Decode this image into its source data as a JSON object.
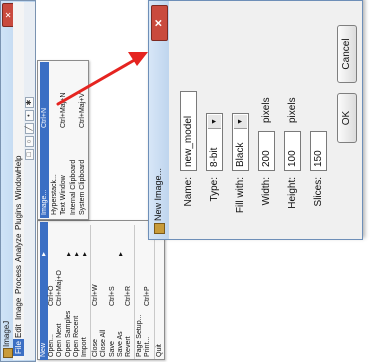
{
  "ij_window": {
    "title": "ImageJ",
    "close_label": "✕",
    "menubar": [
      "File",
      "Edit",
      "Image",
      "Process",
      "Analyze",
      "Plugins",
      "Window",
      "Help"
    ],
    "active_menu": "File",
    "toolbar_glyphs": [
      "□",
      "○",
      "╱",
      "•",
      "✱"
    ]
  },
  "file_menu": {
    "items": [
      {
        "label": "New",
        "shortcut": "",
        "submenu": true,
        "highlighted": true
      },
      {
        "label": "Open...",
        "shortcut": "Ctrl+O"
      },
      {
        "label": "Open Next",
        "shortcut": "Ctrl+Maj+O"
      },
      {
        "label": "Open Samples",
        "shortcut": "",
        "submenu": true
      },
      {
        "label": "Open Recent",
        "shortcut": "",
        "submenu": true
      },
      {
        "label": "Import",
        "shortcut": "",
        "submenu": true
      },
      {
        "separator": true
      },
      {
        "label": "Close",
        "shortcut": "Ctrl+W"
      },
      {
        "label": "Close All",
        "shortcut": ""
      },
      {
        "label": "Save",
        "shortcut": "Ctrl+S"
      },
      {
        "label": "Save As",
        "shortcut": "",
        "submenu": true
      },
      {
        "label": "Revert",
        "shortcut": "Ctrl+R"
      },
      {
        "separator": true
      },
      {
        "label": "Page Setup...",
        "shortcut": ""
      },
      {
        "label": "Print...",
        "shortcut": "Ctrl+P"
      },
      {
        "separator": true
      },
      {
        "label": "Quit",
        "shortcut": ""
      }
    ]
  },
  "new_submenu": {
    "items": [
      {
        "label": "Image...",
        "shortcut": "Ctrl+N",
        "highlighted": true
      },
      {
        "label": "Hyperstack...",
        "shortcut": ""
      },
      {
        "label": "Text Window",
        "shortcut": "Ctrl+Maj+N"
      },
      {
        "label": "Internal Clipboard",
        "shortcut": ""
      },
      {
        "label": "System Clipboard",
        "shortcut": "Ctrl+Maj+V"
      }
    ]
  },
  "dialog": {
    "title": "New Image...",
    "close_label": "✕",
    "name_label": "Name:",
    "name_value": "new_model",
    "type_label": "Type:",
    "type_value": "8-bit",
    "fill_label": "Fill with:",
    "fill_value": "Black",
    "width_label": "Width:",
    "width_value": "200",
    "width_unit": "pixels",
    "height_label": "Height:",
    "height_value": "100",
    "height_unit": "pixels",
    "slices_label": "Slices:",
    "slices_value": "150",
    "ok_label": "OK",
    "cancel_label": "Cancel"
  },
  "colors": {
    "highlight": "#3b6fc4",
    "arrow": "#e52420",
    "close_button": "#c94a3e"
  }
}
